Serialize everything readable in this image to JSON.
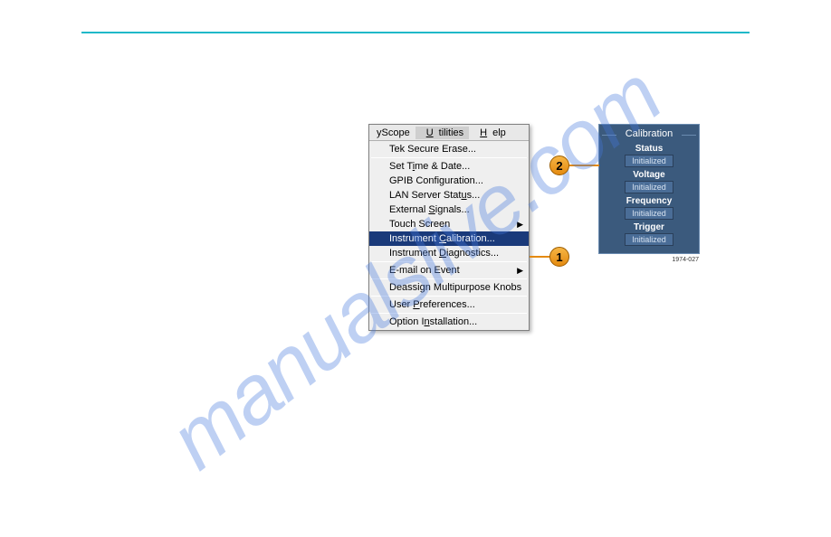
{
  "watermark": "manualslive.com",
  "menubar": {
    "scope": "yScope",
    "utilities": "Utilities",
    "help": "Help"
  },
  "menu": {
    "tek_secure": "Tek Secure Erase...",
    "set_time": "Set Time & Date...",
    "gpib": "GPIB Configuration...",
    "lan": "LAN Server Status...",
    "external": "External Signals...",
    "touch": "Touch Screen",
    "instrument_cal": "Instrument Calibration...",
    "diagnostics": "Instrument Diagnostics...",
    "email": "E-mail on Event",
    "deassign": "Deassign Multipurpose Knobs",
    "user_prefs": "User Preferences...",
    "option_install": "Option Installation..."
  },
  "callouts": {
    "one": "1",
    "two": "2"
  },
  "panel": {
    "title": "Calibration",
    "status_label": "Status",
    "status_value": "Initialized",
    "voltage_label": "Voltage",
    "voltage_value": "Initialized",
    "frequency_label": "Frequency",
    "frequency_value": "Initialized",
    "trigger_label": "Trigger",
    "trigger_value": "Initialized",
    "code": "1974-027"
  }
}
